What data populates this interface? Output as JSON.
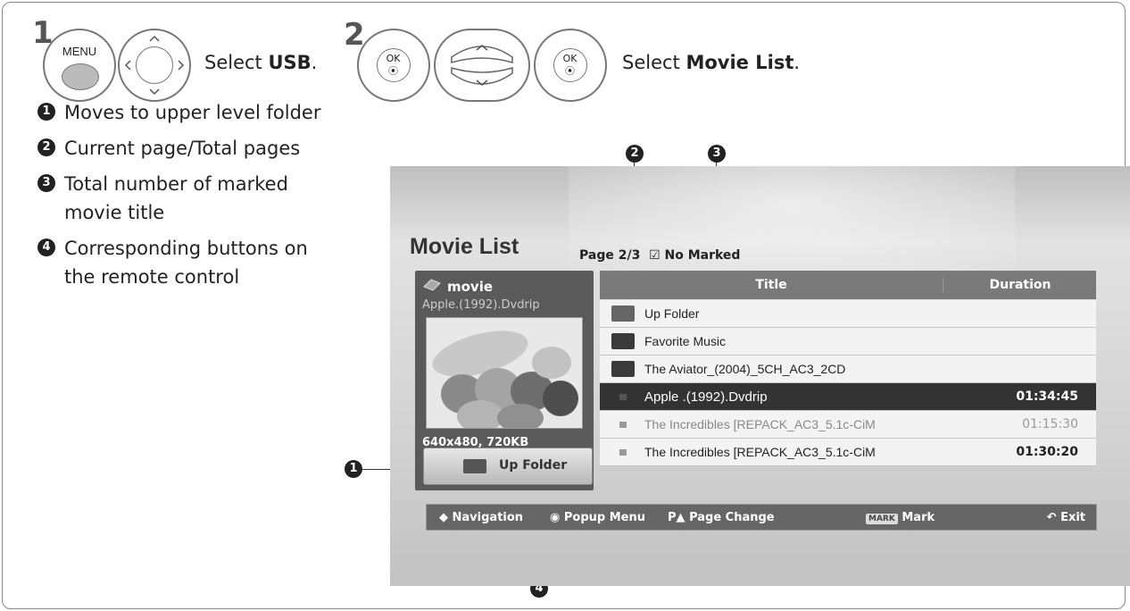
{
  "steps": [
    {
      "number": "1",
      "menu_label": "MENU",
      "text_prefix": "Select ",
      "text_bold": "USB",
      "text_suffix": "."
    },
    {
      "number": "2",
      "ok_label": "OK",
      "text_prefix": "Select ",
      "text_bold": "Movie List",
      "text_suffix": "."
    }
  ],
  "legend": [
    {
      "num": "1",
      "text": "Moves to upper level folder"
    },
    {
      "num": "2",
      "text": "Current page/Total pages"
    },
    {
      "num": "3",
      "text": "Total number of marked movie title"
    },
    {
      "num": "4",
      "text": "Corresponding buttons on the remote control"
    }
  ],
  "callouts": {
    "c1": "1",
    "c2": "2",
    "c3": "3",
    "c4": "4"
  },
  "screen": {
    "title": "Movie List",
    "page": "Page 2/3",
    "marked": "☑ No Marked",
    "left_panel": {
      "title": "movie",
      "filename": "Apple.(1992).Dvdrip",
      "resolution": "640x480, 720KB",
      "up_folder": "Up Folder"
    },
    "table": {
      "col_title": "Title",
      "col_duration": "Duration",
      "rows": [
        {
          "name": "Up Folder",
          "duration": ""
        },
        {
          "name": "Favorite Music",
          "duration": ""
        },
        {
          "name": "The Aviator_(2004)_5CH_AC3_2CD",
          "duration": ""
        },
        {
          "name": "Apple .(1992).Dvdrip",
          "duration": "01:34:45"
        },
        {
          "name": "The Incredibles [REPACK_AC3_5.1c-CiM",
          "duration": "01:15:30"
        },
        {
          "name": "The Incredibles [REPACK_AC3_5.1c-CiM",
          "duration": "01:30:20"
        }
      ]
    },
    "footer": {
      "navigation": "Navigation",
      "popup": "Popup Menu",
      "page_change": "Page Change",
      "mark_key": "MARK",
      "mark": "Mark",
      "exit": "Exit"
    }
  }
}
